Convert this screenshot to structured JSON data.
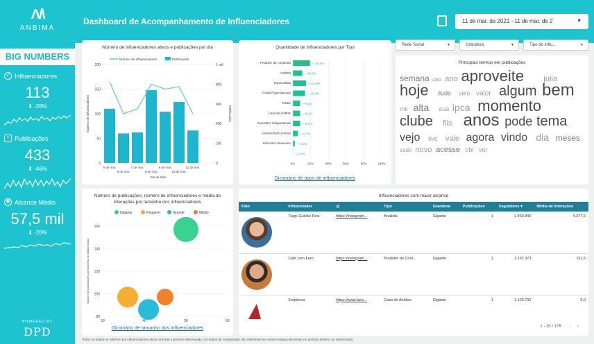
{
  "brand": {
    "logo_mark": "Λ/\\",
    "logo_text": "ANBIMA",
    "powered_by": "POWERED BY",
    "powered_logo": "DPD"
  },
  "header": {
    "title": "Dashboard de Acompanhamento de Influenciadores",
    "date_range": "11 de mar. de 2021 - 11 de mar. de 2",
    "calendar_icon": "calendar-icon"
  },
  "sidebar": {
    "section": "BIG NUMBERS",
    "kpis": [
      {
        "label": "Influenciadores",
        "value": "113",
        "delta": "⬇ -28%",
        "icon": "check-circle-icon"
      },
      {
        "label": "Publicações",
        "value": "433",
        "delta": "⬇ -46%",
        "icon": "document-icon"
      },
      {
        "label": "Alcance Médio",
        "value": "57,5 mil",
        "delta": "⬇ -20%",
        "icon": "eye-icon"
      }
    ]
  },
  "filters": [
    {
      "label": "Rede Social"
    },
    {
      "label": "Grandeza"
    },
    {
      "label": "Tipo de Influ..."
    }
  ],
  "chart1": {
    "title": "Número de influenciadores ativos e publicações por dia",
    "legend": [
      "Número de Influenciadores",
      "Publicações"
    ],
    "ylabel": "Número de Influenciadores",
    "y2label": "Publicações",
    "xlabel": "Dia de Mês"
  },
  "chart2": {
    "title": "Quantidade de Influenciadores por Tipo",
    "link": "Dicionário de tipos de influenciadores"
  },
  "wordcloud": {
    "title": "Principais termos em publicações",
    "words": [
      [
        "semana",
        12
      ],
      [
        "uso",
        9
      ],
      [
        "ano",
        11
      ],
      [
        "aproveite",
        22
      ],
      [
        "julia",
        11
      ],
      [
        "hoje",
        22
      ],
      [
        "iludo",
        9
      ],
      [
        "veio",
        9
      ],
      [
        "valor",
        10
      ],
      [
        "algum",
        20
      ],
      [
        "bem",
        24
      ],
      [
        "mil",
        9
      ],
      [
        "alta",
        14
      ],
      [
        "eua",
        9
      ],
      [
        "ipca",
        14
      ],
      [
        "momento",
        22
      ],
      [
        "clube",
        20
      ],
      [
        "fiis",
        11
      ],
      [
        "anos",
        24
      ],
      [
        "pode",
        18
      ],
      [
        "tema",
        20
      ],
      [
        "vejo",
        16
      ],
      [
        "live",
        9
      ],
      [
        "vale",
        11
      ],
      [
        "agora",
        16
      ],
      [
        "vindo",
        16
      ],
      [
        "dia",
        14
      ],
      [
        "meses",
        12
      ],
      [
        "zade",
        8
      ],
      [
        "novo",
        11
      ],
      [
        "acesse",
        11
      ],
      [
        "obr",
        9
      ],
      [
        "ver",
        9
      ]
    ]
  },
  "chart4": {
    "title": "Número de publicações, número de influenciadores e média de interações por tamanho dos influenciadores",
    "legend": [
      "Gigante",
      "Pequeno",
      "Grande",
      "Médio"
    ],
    "ylabel": "Número de publicações por tamanho do influenciador",
    "xlabel": "Número de influenciadores por tamanho do influenciador",
    "link": "Dicionário de tamanho dos influenciadores"
  },
  "table": {
    "title": "Influenciadores com maior alcance",
    "columns": [
      "Foto",
      "Influenciador",
      "@",
      "Tipo",
      "Grandeza",
      "Publicações",
      "Seguidores ▾",
      "Média de Interações"
    ],
    "rows": [
      {
        "name": "Tiago Guitián Reis",
        "handle": "https://instagram...",
        "tipo": "Analista",
        "grandeza": "Gigante",
        "pubs": "1",
        "seg": "1.469.840",
        "media": "4.377,5"
      },
      {
        "name": "Café com Ferri",
        "handle": "https://instagram...",
        "tipo": "Produtor de Cont...",
        "grandeza": "Gigante",
        "pubs": "1",
        "seg": "1.192.373",
        "media": "151,5"
      },
      {
        "name": "Empiricus",
        "handle": "https://www.face...",
        "tipo": "Casa de Análise",
        "grandeza": "Gigante",
        "pubs": "1",
        "seg": "1.120.792",
        "media": "9,0"
      }
    ],
    "pager": "1 - 20 / 176"
  },
  "footnote": "Todos os dados se referem aos influenciadores ativos durante o período selecionado. Os dados de comparação são referentes ao mesmo espaço de tempo no período anterior ao selecionado.",
  "colors": {
    "accent": "#1ec3d0",
    "bar": "#1fb5cc",
    "hbar": "#20c090",
    "line": "#6ad0b0",
    "table_header": "#1f7f98"
  },
  "chart_data": [
    {
      "type": "bar",
      "title": "Número de influenciadores ativos e publicações por dia",
      "categories": [
        "5 de mar.",
        "6 de mar.",
        "7 de mar.",
        "8 de mar.",
        "9 de mar.",
        "10 de mar.",
        "11 de mar.",
        "12 de mar."
      ],
      "series": [
        {
          "name": "Publicações",
          "type": "bar",
          "values": [
            550,
            300,
            310,
            740,
            520,
            620,
            330,
            0
          ]
        },
        {
          "name": "Número de Influenciadores",
          "type": "line",
          "values": [
            165,
            100,
            110,
            160,
            150,
            155,
            100,
            0
          ]
        }
      ],
      "xlabel": "Dia de Mês",
      "ylabel": "Número de Influenciadores",
      "y2label": "Publicações",
      "ylim": [
        0,
        200
      ],
      "y2lim": [
        0,
        1000
      ],
      "y_ticks": [
        "0",
        "50",
        "100",
        "150",
        "200"
      ],
      "y2_ticks": [
        "0",
        "200",
        "400",
        "600",
        "800",
        "1 mil"
      ]
    },
    {
      "type": "bar",
      "orientation": "horizontal",
      "title": "Quantidade de Influenciadores por Tipo",
      "categories": [
        "Produtor de Conteúdo",
        "Analista",
        "Especialista",
        "Portal Especializado",
        "Trader",
        "Casa de Análise",
        "Investidor Independente",
        "Assessoria/Corretora",
        "Educador financeiro"
      ],
      "values": [
        19.4,
        10.6,
        14.9,
        13.8,
        8.2,
        8.2,
        8.2,
        5.7,
        2.2
      ],
      "labels": [
        "19,4%",
        "10,6%",
        "14,9%",
        "13,8%",
        "8,2%",
        "8,2%",
        "8,2%",
        "5,7%",
        "2,2%",
        "1,4%"
      ],
      "xlim": [
        0,
        100
      ],
      "x_ticks": [
        "0%",
        "20%",
        "40%",
        "60%",
        "80%",
        "100%"
      ]
    },
    {
      "type": "scatter",
      "title": "Número de publicações, número de influenciadores e média de interações por tamanho dos influenciadores",
      "series": [
        {
          "name": "Gigante",
          "x": 50,
          "y": 157,
          "size": 18,
          "color": "#2ed08a"
        },
        {
          "name": "Pequeno",
          "x": 36,
          "y": 97,
          "size": 15,
          "color": "#f7a828"
        },
        {
          "name": "Grande",
          "x": 41,
          "y": 86,
          "size": 15,
          "color": "#1fb8d4"
        },
        {
          "name": "Médio",
          "x": 45,
          "y": 97,
          "size": 12,
          "color": "#f07a20"
        }
      ],
      "xlim": [
        30,
        60
      ],
      "ylim": [
        80,
        160
      ],
      "x_ticks": [
        "30",
        "40",
        "50",
        "60"
      ],
      "y_ticks": [
        "80",
        "100",
        "120",
        "140",
        "160"
      ]
    }
  ]
}
